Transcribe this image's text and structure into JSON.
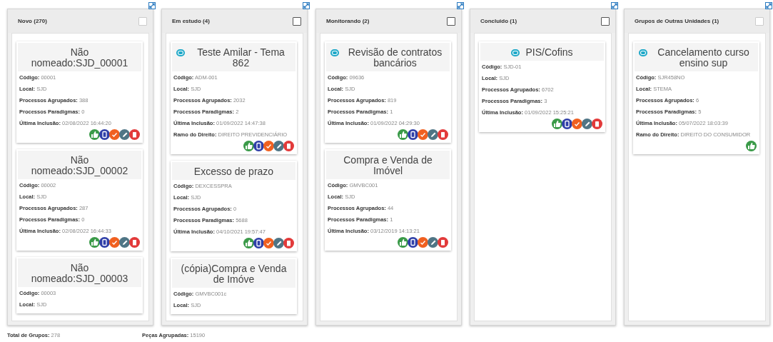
{
  "columns": [
    {
      "title": "Novo (270)",
      "disabled": true,
      "cards": [
        {
          "title": "Não nomeado:SJD_00001",
          "comment": false,
          "fields": [
            "**Código:** 00001",
            "**Local:** SJD",
            "**Processos Agrupados:** 388",
            "**Processos Paradigmas:** 0",
            "**Última Inclusão:** 02/08/2022 16:44:20"
          ],
          "actions": [
            {
              "kind": "approve"
            },
            {
              "kind": "document"
            },
            {
              "kind": "check"
            },
            {
              "kind": "edit"
            },
            {
              "kind": "delete"
            }
          ]
        },
        {
          "title": "Não nomeado:SJD_00002",
          "comment": false,
          "fields": [
            "**Código:** 00002",
            "**Local:** SJD",
            "**Processos Agrupados:** 287",
            "**Processos Paradigmas:** 0",
            "**Última Inclusão:** 02/08/2022 16:44:33"
          ],
          "actions": [
            {
              "kind": "approve"
            },
            {
              "kind": "document"
            },
            {
              "kind": "check"
            },
            {
              "kind": "edit"
            },
            {
              "kind": "delete"
            }
          ]
        },
        {
          "title": "Não nomeado:SJD_00003",
          "comment": false,
          "fields": [
            "**Código:** 00003",
            "**Local:** SJD"
          ]
        }
      ]
    },
    {
      "title": "Em estudo (4)",
      "disabled": false,
      "cards": [
        {
          "title": "Teste Amilar - Tema 862",
          "comment": true,
          "fields": [
            "**Código:** ADM-001",
            "**Local:** SJD",
            "**Processos Agrupados:** 2032",
            "**Processos Paradigmas:** 2",
            "**Última Inclusão:** 01/09/2022 14:47:38",
            "**Ramo do Direito:** DIREITO PREVIDENCIÁRIO"
          ],
          "actions": [
            {
              "kind": "approve"
            },
            {
              "kind": "document"
            },
            {
              "kind": "check"
            },
            {
              "kind": "edit"
            },
            {
              "kind": "delete"
            }
          ]
        },
        {
          "title": "Excesso de prazo",
          "comment": false,
          "fields": [
            "**Código:** DEXCESSPRA",
            "**Local:** SJD",
            "**Processos Agrupados:** 0",
            "**Processos Paradigmas:** 5688",
            "**Última Inclusão:** 04/10/2021 19:57:47"
          ],
          "actions": [
            {
              "kind": "approve"
            },
            {
              "kind": "document"
            },
            {
              "kind": "check"
            },
            {
              "kind": "edit"
            },
            {
              "kind": "delete"
            }
          ]
        },
        {
          "title": "(cópia)Compra e Venda de Imóve",
          "comment": false,
          "fields": [
            "**Código:** GMVBC001c",
            "**Local:** SJD"
          ]
        }
      ]
    },
    {
      "title": "Monitorando (2)",
      "disabled": false,
      "cards": [
        {
          "title": "Revisão de contratos bancários",
          "comment": true,
          "fields": [
            "**Código:** 09636",
            "**Local:** SJD",
            "**Processos Agrupados:** 819",
            "**Processos Paradigmas:** 1",
            "**Última Inclusão:** 01/09/2022 04:29:30"
          ],
          "actions": [
            {
              "kind": "approve"
            },
            {
              "kind": "document"
            },
            {
              "kind": "check"
            },
            {
              "kind": "edit"
            },
            {
              "kind": "delete"
            }
          ]
        },
        {
          "title": "Compra e Venda de Imóvel",
          "comment": false,
          "fields": [
            "**Código:** GMVBC001",
            "**Local:** SJD",
            "**Processos Agrupados:** 44",
            "**Processos Paradigmas:** 1",
            "**Última Inclusão:** 03/12/2019 14:13:21"
          ],
          "actions": [
            {
              "kind": "approve"
            },
            {
              "kind": "document"
            },
            {
              "kind": "check"
            },
            {
              "kind": "edit"
            },
            {
              "kind": "delete"
            }
          ]
        }
      ]
    },
    {
      "title": "Concluido (1)",
      "disabled": false,
      "cards": [
        {
          "title": "PIS/Cofins",
          "comment": true,
          "fields": [
            "**Código:** SJD-01",
            "**Local:** SJD",
            "**Processos Agrupados:** 6702",
            "**Processos Paradigmas:** 3",
            "**Última Inclusão:** 01/09/2022 15:25:21"
          ],
          "actions": [
            {
              "kind": "approve"
            },
            {
              "kind": "document"
            },
            {
              "kind": "check"
            },
            {
              "kind": "edit"
            },
            {
              "kind": "delete"
            }
          ]
        }
      ]
    },
    {
      "title": "Grupos de Outras Unidades (1)",
      "disabled": true,
      "cards": [
        {
          "title": "Cancelamento curso ensino sup",
          "comment": true,
          "fields": [
            "**Código:** SJR458NO",
            "**Local:** STEMA",
            "**Processos Agrupados:** 6",
            "**Processos Paradigmas:** 5",
            "**Última Inclusão:** 05/07/2022 18:03:39",
            "**Ramo do Direito:** DIREITO DO CONSUMIDOR"
          ],
          "actions": [
            {
              "kind": "approve"
            }
          ]
        }
      ]
    }
  ],
  "footer": [
    "**Total de Grupos:** 278",
    "**Peças Agrupadas:** 15190"
  ]
}
